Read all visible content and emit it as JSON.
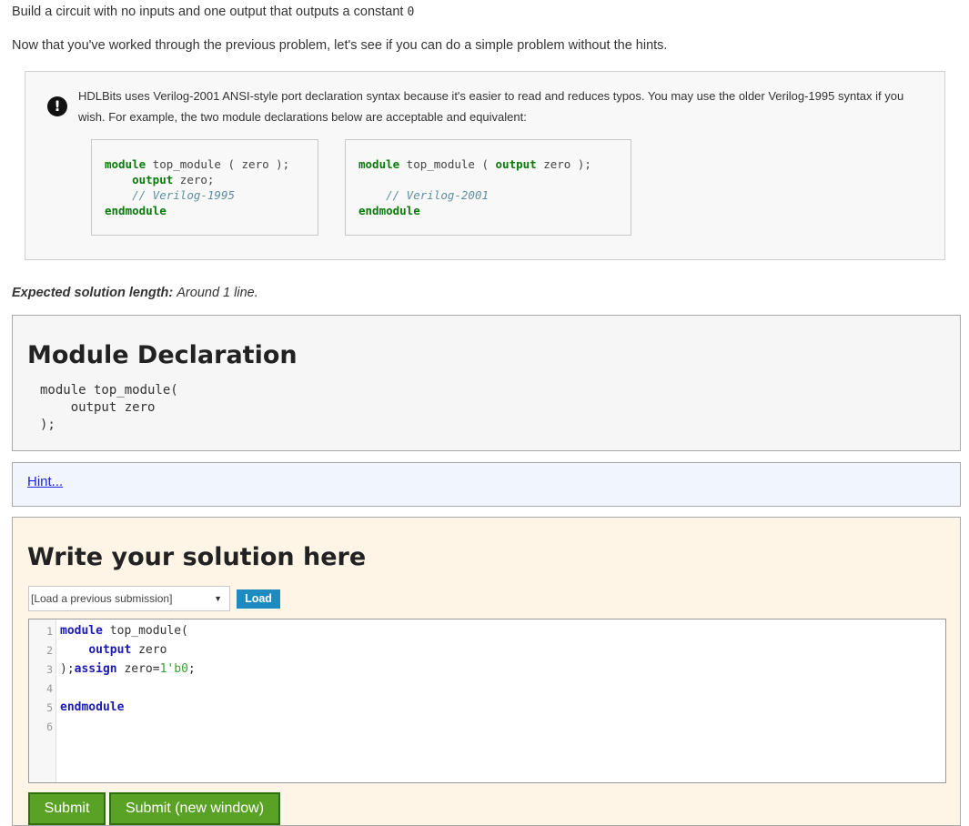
{
  "intro": {
    "line1": "Build a circuit with no inputs and one output that outputs a constant ",
    "line1_code": "0",
    "line2": "Now that you've worked through the previous problem, let's see if you can do a simple problem without the hints."
  },
  "note": {
    "icon": "exclamation-icon",
    "text": "HDLBits uses Verilog-2001 ANSI-style port declaration syntax because it's easier to read and reduces typos. You may use the older Verilog-1995 syntax if you wish. For example, the two module declarations below are acceptable and equivalent:",
    "code1995": {
      "l1_kw": "module",
      "l1_rest": " top_module ( zero );",
      "l2_kw": "output",
      "l2_rest": " zero;",
      "l3_comment": "// Verilog-1995",
      "l4_kw": "endmodule"
    },
    "code2001": {
      "l1_kw": "module",
      "l1_mid": " top_module ( ",
      "l1_kw2": "output",
      "l1_rest": " zero );",
      "l3_comment": "// Verilog-2001",
      "l4_kw": "endmodule"
    }
  },
  "expected": {
    "label": "Expected solution length:",
    "value": "Around 1 line."
  },
  "declaration": {
    "title": "Module Declaration",
    "lines": [
      "module top_module(",
      "    output zero",
      ");"
    ]
  },
  "hint": {
    "label": "Hint..."
  },
  "solution": {
    "title": "Write your solution here",
    "select_value": "[Load a previous submission]",
    "load_label": "Load",
    "editor": {
      "line_numbers": [
        "1",
        "2",
        "3",
        "4",
        "5",
        "6"
      ],
      "l1_kw": "module",
      "l1_rest": " top_module(",
      "l2_kw": "output",
      "l2_rest": " zero",
      "l3_a": ");",
      "l3_kw": "assign",
      "l3_b": " zero=",
      "l3_num": "1'b0",
      "l3_c": ";",
      "l5_kw": "endmodule"
    },
    "submit_label": "Submit",
    "submit_new_label": "Submit (new window)"
  }
}
